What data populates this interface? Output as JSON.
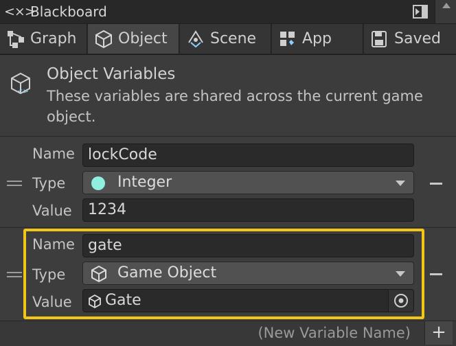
{
  "window": {
    "title": "Blackboard",
    "title_icon": "blackboard-icon"
  },
  "tabs": [
    {
      "label": "Graph",
      "icon": "graph-icon",
      "active": false
    },
    {
      "label": "Object",
      "icon": "object-cube-icon",
      "active": true
    },
    {
      "label": "Scene",
      "icon": "scene-icon",
      "active": false
    },
    {
      "label": "App",
      "icon": "app-icon",
      "active": false
    },
    {
      "label": "Saved",
      "icon": "saved-icon",
      "active": false
    }
  ],
  "header": {
    "title": "Object Variables",
    "description": "These variables are shared across the current game object.",
    "icon": "object-variables-icon"
  },
  "labels": {
    "name": "Name",
    "type": "Type",
    "value": "Value"
  },
  "variables": [
    {
      "name": "lockCode",
      "type": "Integer",
      "type_icon": "integer-dot-icon",
      "value": "1234",
      "highlighted": false
    },
    {
      "name": "gate",
      "type": "Game Object",
      "type_icon": "game-object-icon",
      "value": "Gate",
      "value_icon": "game-object-icon",
      "highlighted": true
    }
  ],
  "footer": {
    "new_variable_placeholder": "(New Variable Name)",
    "add_label": "+"
  },
  "colors": {
    "highlight": "#f2c617",
    "integer_dot": "#8ff0e0"
  }
}
